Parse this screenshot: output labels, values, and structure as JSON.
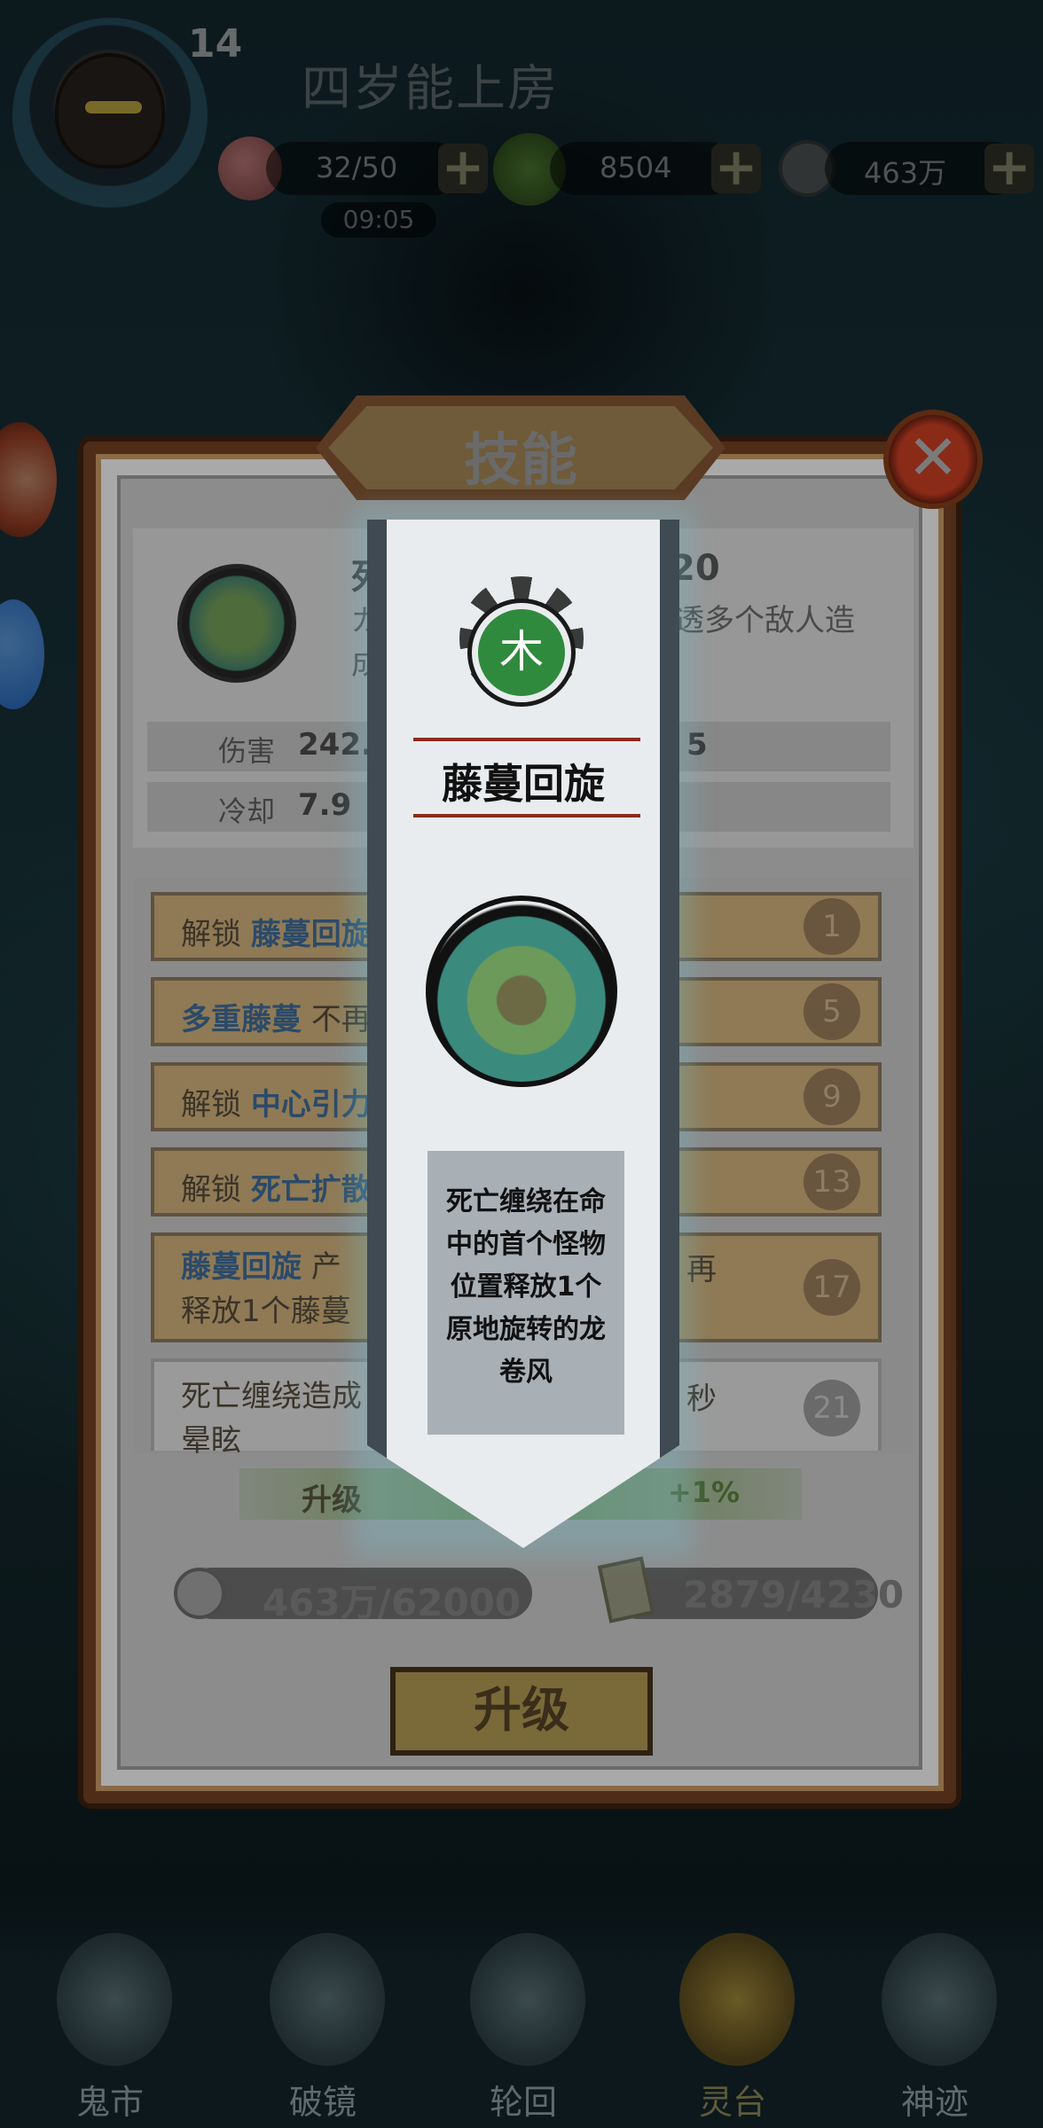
{
  "player": {
    "level": "14",
    "name": "四岁能上房"
  },
  "resources": {
    "stamina": "32/50",
    "jade": "8504",
    "coins": "463万",
    "timer": "09:05"
  },
  "panel": {
    "title": "技能",
    "skill": {
      "name_fragment": "死",
      "level_fragment": "20",
      "desc_fragment_left": "ガ",
      "desc_fragment_left2": "成",
      "desc_fragment_right": "透多个敌人造"
    },
    "stats": [
      {
        "label": "伤害",
        "value_left": "242.",
        "value_right": "5"
      },
      {
        "label": "冷却",
        "value_left": "7.9",
        "value_right": ""
      }
    ],
    "upgrades": [
      {
        "prefix": "解锁",
        "keyword": "藤蔓回旋",
        "rest": "",
        "level": "1"
      },
      {
        "prefix": "",
        "keyword": "多重藤蔓",
        "rest": "不再",
        "level": "5"
      },
      {
        "prefix": "解锁",
        "keyword": "中心引力",
        "rest": "",
        "level": "9"
      },
      {
        "prefix": "解锁",
        "keyword": "死亡扩散",
        "rest": "",
        "level": "13"
      },
      {
        "prefix": "",
        "keyword": "藤蔓回旋",
        "rest": "产",
        "rest_right": "再",
        "line2": "释放1个藤蔓",
        "level": "17"
      },
      {
        "prefix": "",
        "keyword": "",
        "rest": "死亡缠绕造成",
        "rest_right": "秒",
        "line2": "晕眩",
        "level": "21"
      }
    ],
    "boost_left": "升级",
    "boost_right": "+1%",
    "cost_coins": "463万/62000",
    "cost_scrolls": "2879/4230",
    "upgrade_button": "升级"
  },
  "popup": {
    "element": "木",
    "title": "藤蔓回旋",
    "description_lines": [
      "死亡缠绕在命",
      "中的首个怪物",
      "位置释放1个",
      "原地旋转的龙",
      "卷风"
    ]
  },
  "nav": [
    {
      "label": "鬼市",
      "active": false
    },
    {
      "label": "破镜",
      "active": false
    },
    {
      "label": "轮回",
      "active": false
    },
    {
      "label": "灵台",
      "active": true
    },
    {
      "label": "神迹",
      "active": false
    }
  ],
  "colors": {
    "element_wood": "#2f8a3d",
    "banner_red_rule": "#8c2a1c",
    "keyword_blue": "#2b4a6a"
  }
}
